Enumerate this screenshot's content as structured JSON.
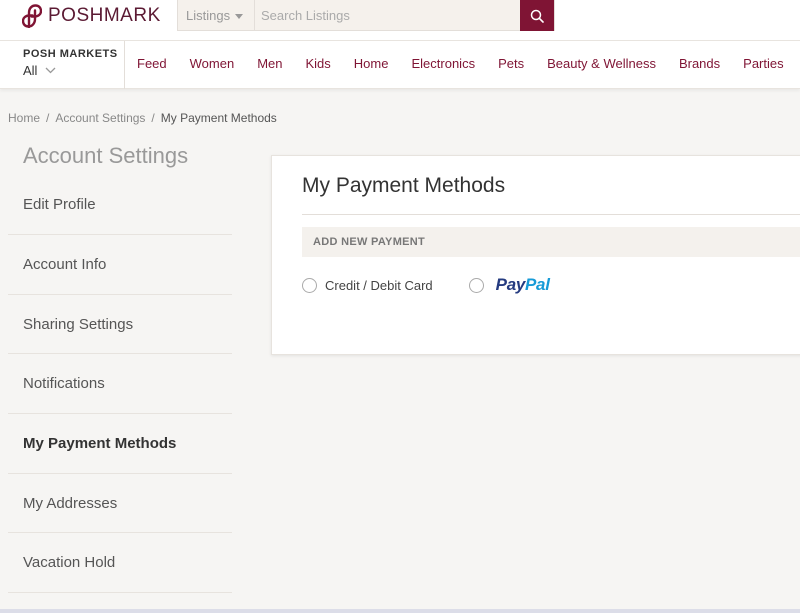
{
  "header": {
    "brand": "POSHMARK",
    "search": {
      "category": "Listings",
      "placeholder": "Search Listings"
    }
  },
  "nav": {
    "posh_markets_title": "POSH MARKETS",
    "posh_markets_value": "All",
    "links": [
      "Feed",
      "Women",
      "Men",
      "Kids",
      "Home",
      "Electronics",
      "Pets",
      "Beauty & Wellness",
      "Brands",
      "Parties"
    ]
  },
  "breadcrumb": {
    "home": "Home",
    "account_settings": "Account Settings",
    "current": "My Payment Methods"
  },
  "sidebar": {
    "title": "Account Settings",
    "items": [
      {
        "label": "Edit Profile"
      },
      {
        "label": "Account Info"
      },
      {
        "label": "Sharing Settings"
      },
      {
        "label": "Notifications"
      },
      {
        "label": "My Payment Methods",
        "active": true
      },
      {
        "label": "My Addresses"
      },
      {
        "label": "Vacation Hold"
      }
    ]
  },
  "main": {
    "title": "My Payment Methods",
    "section_header": "ADD NEW PAYMENT",
    "options": {
      "card_label": "Credit / Debit Card",
      "paypal_part1": "Pay",
      "paypal_part2": "Pal"
    }
  },
  "colors": {
    "brand": "#7f1434",
    "paypal_dark": "#253b80",
    "paypal_light": "#179bd7"
  }
}
